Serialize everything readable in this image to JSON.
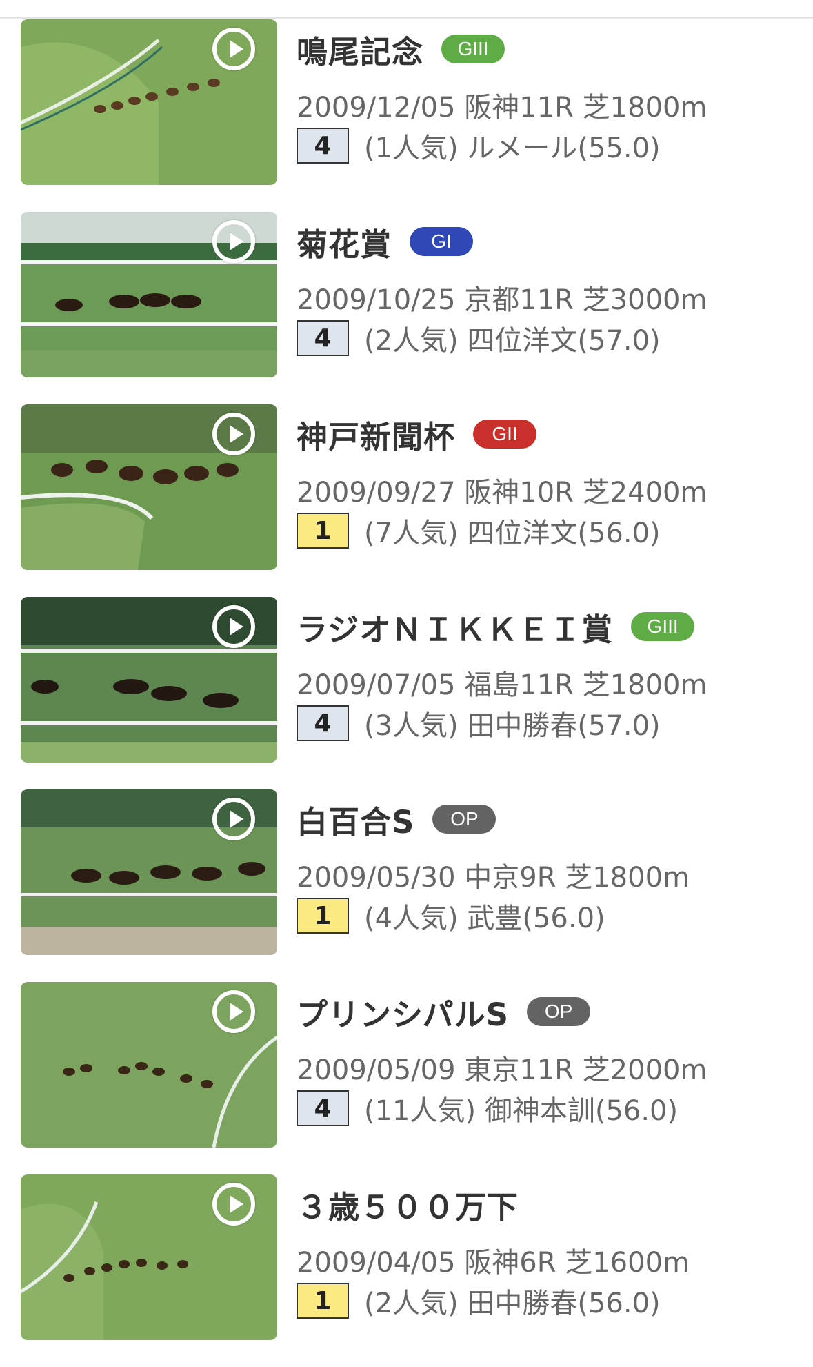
{
  "races": [
    {
      "name": "鳴尾記念",
      "grade": "GIII",
      "grade_color": "#5fac47",
      "info": "2009/12/05 阪神11R 芝1800m",
      "rank": "4",
      "rank_bg": "#dfe5ec",
      "jockey": "(1人気) ルメール(55.0)",
      "thumb_icon": "play-icon"
    },
    {
      "name": "菊花賞",
      "grade": "GI",
      "grade_color": "#3048b6",
      "info": "2009/10/25 京都11R 芝3000m",
      "rank": "4",
      "rank_bg": "#dfe5ec",
      "jockey": "(2人気) 四位洋文(57.0)",
      "thumb_icon": "play-icon"
    },
    {
      "name": "神戸新聞杯",
      "grade": "GII",
      "grade_color": "#c9302b",
      "info": "2009/09/27 阪神10R 芝2400m",
      "rank": "1",
      "rank_bg": "#fbea82",
      "jockey": "(7人気) 四位洋文(56.0)",
      "thumb_icon": "play-icon"
    },
    {
      "name": "ラジオＮＩＫＫＥＩ賞",
      "grade": "GIII",
      "grade_color": "#5fac47",
      "info": "2009/07/05 福島11R 芝1800m",
      "rank": "4",
      "rank_bg": "#dfe5ec",
      "jockey": "(3人気) 田中勝春(57.0)",
      "thumb_icon": "play-icon"
    },
    {
      "name": "白百合S",
      "grade": "OP",
      "grade_color": "#636363",
      "info": "2009/05/30 中京9R 芝1800m",
      "rank": "1",
      "rank_bg": "#fbea82",
      "jockey": "(4人気) 武豊(56.0)",
      "thumb_icon": "play-icon"
    },
    {
      "name": "プリンシパルS",
      "grade": "OP",
      "grade_color": "#636363",
      "info": "2009/05/09 東京11R 芝2000m",
      "rank": "4",
      "rank_bg": "#dfe5ec",
      "jockey": "(11人気) 御神本訓(56.0)",
      "thumb_icon": "play-icon"
    },
    {
      "name": "３歳５００万下",
      "grade": "",
      "grade_color": "",
      "info": "2009/04/05 阪神6R 芝1600m",
      "rank": "1",
      "rank_bg": "#fbea82",
      "jockey": "(2人気) 田中勝春(56.0)",
      "thumb_icon": "play-icon"
    }
  ]
}
